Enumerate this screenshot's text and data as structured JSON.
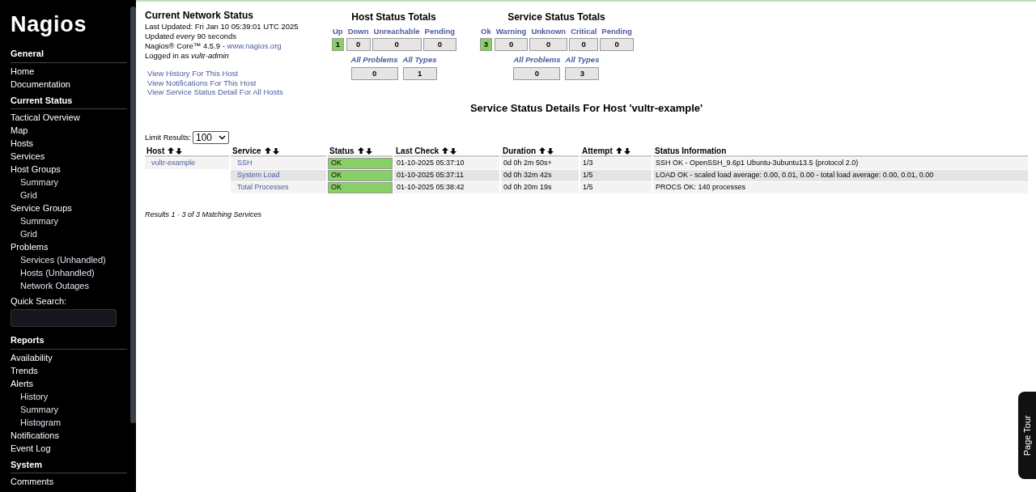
{
  "sidebar": {
    "logo": "Nagios",
    "sections": [
      {
        "heading": "General",
        "items": [
          {
            "label": "Home"
          },
          {
            "label": "Documentation"
          }
        ]
      },
      {
        "heading": "Current Status",
        "items": [
          {
            "label": "Tactical Overview"
          },
          {
            "label": "Map"
          },
          {
            "label": "Hosts"
          },
          {
            "label": "Services"
          },
          {
            "label": "Host Groups",
            "children": [
              {
                "label": "Summary"
              },
              {
                "label": "Grid"
              }
            ]
          },
          {
            "label": "Service Groups",
            "children": [
              {
                "label": "Summary"
              },
              {
                "label": "Grid"
              }
            ]
          },
          {
            "label": "Problems",
            "children": [
              {
                "label": "Services (Unhandled)"
              },
              {
                "label": "Hosts (Unhandled)"
              },
              {
                "label": "Network Outages"
              }
            ]
          }
        ],
        "search_label": "Quick Search:"
      },
      {
        "heading": "Reports",
        "items": [
          {
            "label": "Availability"
          },
          {
            "label": "Trends"
          },
          {
            "label": "Alerts",
            "children": [
              {
                "label": "History"
              },
              {
                "label": "Summary"
              },
              {
                "label": "Histogram"
              }
            ]
          },
          {
            "label": "Notifications"
          },
          {
            "label": "Event Log"
          }
        ]
      },
      {
        "heading": "System",
        "items": [
          {
            "label": "Comments"
          }
        ]
      }
    ]
  },
  "info": {
    "title": "Current Network Status",
    "last_updated": "Last Updated: Fri Jan 10 05:39:01 UTC 2025",
    "interval": "Updated every 90 seconds",
    "version": "Nagios® Core™ 4.5.9 - ",
    "version_link": "www.nagios.org",
    "logged_in": "Logged in as ",
    "user": "vultr-admin",
    "links": [
      "View History For This Host",
      "View Notifications For This Host",
      "View Service Status Detail For All Hosts"
    ]
  },
  "host_totals": {
    "title": "Host Status Totals",
    "cells": [
      {
        "label": "Up",
        "value": "1",
        "highlight": true
      },
      {
        "label": "Down",
        "value": "0",
        "highlight": false
      },
      {
        "label": "Unreachable",
        "value": "0",
        "highlight": false
      },
      {
        "label": "Pending",
        "value": "0",
        "highlight": false
      }
    ],
    "summary": [
      {
        "label": "All Problems",
        "value": "0"
      },
      {
        "label": "All Types",
        "value": "1"
      }
    ]
  },
  "service_totals": {
    "title": "Service Status Totals",
    "cells": [
      {
        "label": "Ok",
        "value": "3",
        "highlight": true
      },
      {
        "label": "Warning",
        "value": "0",
        "highlight": false
      },
      {
        "label": "Unknown",
        "value": "0",
        "highlight": false
      },
      {
        "label": "Critical",
        "value": "0",
        "highlight": false
      },
      {
        "label": "Pending",
        "value": "0",
        "highlight": false
      }
    ],
    "summary": [
      {
        "label": "All Problems",
        "value": "0"
      },
      {
        "label": "All Types",
        "value": "3"
      }
    ]
  },
  "details": {
    "title": "Service Status Details For Host 'vultr-example'",
    "limit_label": "Limit Results:",
    "limit_value": "100",
    "columns": [
      {
        "label": "Host",
        "sortable": true
      },
      {
        "label": "Service",
        "sortable": true
      },
      {
        "label": "Status",
        "sortable": true
      },
      {
        "label": "Last Check",
        "sortable": true
      },
      {
        "label": "Duration",
        "sortable": true
      },
      {
        "label": "Attempt",
        "sortable": true
      },
      {
        "label": "Status Information",
        "sortable": false
      }
    ],
    "rows": [
      {
        "host": "vultr-example",
        "service": "SSH",
        "status": "OK",
        "last_check": "01-10-2025 05:37:10",
        "duration": "0d 0h 2m 50s+",
        "attempt": "1/3",
        "info": "SSH OK - OpenSSH_9.6p1 Ubuntu-3ubuntu13.5 (protocol 2.0)"
      },
      {
        "service": "System Load",
        "status": "OK",
        "last_check": "01-10-2025 05:37:11",
        "duration": "0d 0h 32m 42s",
        "attempt": "1/5",
        "info": "LOAD OK - scaled load average: 0.00, 0.01, 0.00 - total load average: 0.00, 0.01, 0.00"
      },
      {
        "service": "Total Processes",
        "status": "OK",
        "last_check": "01-10-2025 05:38:42",
        "duration": "0d 0h 20m 19s",
        "attempt": "1/5",
        "info": "PROCS OK: 140 processes"
      }
    ],
    "results": "Results 1 - 3 of 3 Matching Services"
  },
  "page_tour": "Page Tour"
}
